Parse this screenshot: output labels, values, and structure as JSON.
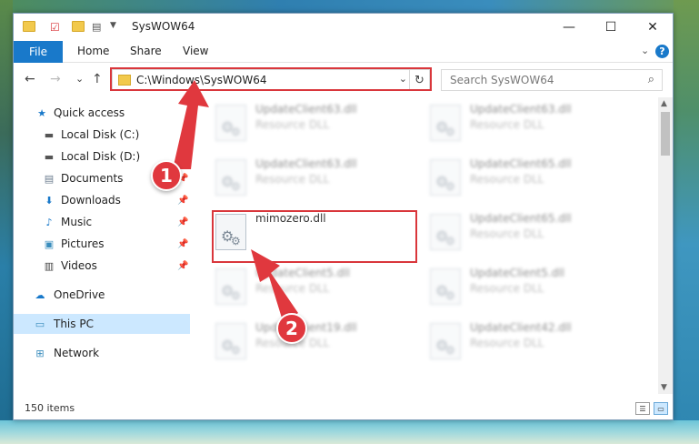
{
  "window": {
    "title": "SysWOW64",
    "controls": {
      "minimize": "—",
      "maximize": "☐",
      "close": "✕"
    }
  },
  "ribbon": {
    "tabs": [
      {
        "label": "File"
      },
      {
        "label": "Home"
      },
      {
        "label": "Share"
      },
      {
        "label": "View"
      }
    ],
    "expand": "⌄",
    "help": "?"
  },
  "nav": {
    "back": "←",
    "forward": "→",
    "recent": "⌄",
    "up": "↑"
  },
  "address": {
    "path": "C:\\Windows\\SysWOW64",
    "dropdown": "⌄",
    "refresh": "↻"
  },
  "search": {
    "placeholder": "Search SysWOW64",
    "icon": "search-icon"
  },
  "sidebar": {
    "items": [
      {
        "label": "Quick access",
        "icon": "star-icon",
        "pinned": false
      },
      {
        "label": "Local Disk (C:)",
        "icon": "drive-icon",
        "pinned": false
      },
      {
        "label": "Local Disk (D:)",
        "icon": "drive-icon",
        "pinned": false
      },
      {
        "label": "Documents",
        "icon": "documents-icon",
        "pinned": true
      },
      {
        "label": "Downloads",
        "icon": "downloads-icon",
        "pinned": true
      },
      {
        "label": "Music",
        "icon": "music-icon",
        "pinned": true
      },
      {
        "label": "Pictures",
        "icon": "pictures-icon",
        "pinned": true
      },
      {
        "label": "Videos",
        "icon": "videos-icon",
        "pinned": true
      },
      {
        "label": "OneDrive",
        "icon": "cloud-icon",
        "pinned": false
      },
      {
        "label": "This PC",
        "icon": "computer-icon",
        "pinned": false,
        "selected": true
      },
      {
        "label": "Network",
        "icon": "network-icon",
        "pinned": false
      }
    ]
  },
  "files": [
    {
      "name": "UpdateClient63.dll",
      "type": "Resource DLL",
      "blurred": true
    },
    {
      "name": "UpdateClient63.dll",
      "type": "Resource DLL",
      "blurred": true
    },
    {
      "name": "UpdateClient63.dll",
      "type": "Resource DLL",
      "blurred": true
    },
    {
      "name": "UpdateClient65.dll",
      "type": "Resource DLL",
      "blurred": true
    },
    {
      "name": "mimozero.dll",
      "type": "",
      "blurred": false
    },
    {
      "name": "UpdateClient65.dll",
      "type": "Resource DLL",
      "blurred": true
    },
    {
      "name": "UpdateClient5.dll",
      "type": "Resource DLL",
      "blurred": true
    },
    {
      "name": "UpdateClient5.dll",
      "type": "Resource DLL",
      "blurred": true
    },
    {
      "name": "UpdateClient19.dll",
      "type": "Resource DLL",
      "blurred": true
    },
    {
      "name": "UpdateClient42.dll",
      "type": "Resource DLL",
      "blurred": true
    }
  ],
  "status": {
    "items": "150 items"
  },
  "annotations": {
    "step1": "1",
    "step2": "2"
  },
  "colors": {
    "accent": "#1979ca",
    "highlight": "#d9363b",
    "selected": "#cce8ff"
  }
}
